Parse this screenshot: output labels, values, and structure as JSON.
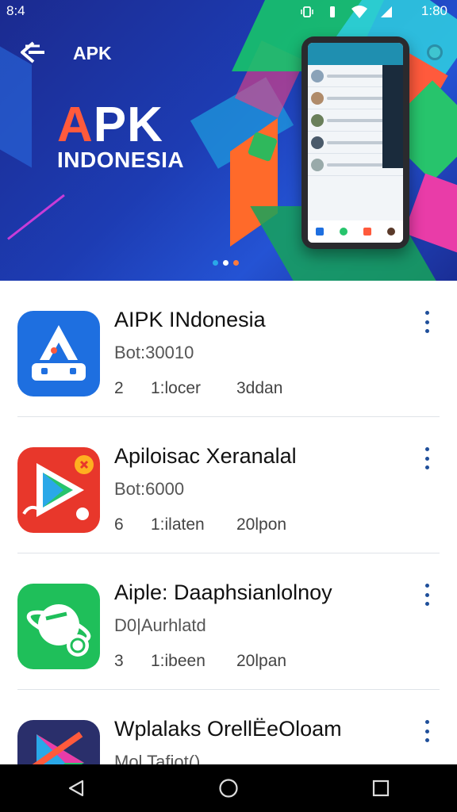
{
  "status_bar": {
    "time": "8:4",
    "clock": "1:80"
  },
  "header": {
    "title": "APK"
  },
  "banner": {
    "logo_accent": "A",
    "logo_rest": "PK",
    "subtitle": "INDONESIA",
    "carousel_count": 3,
    "carousel_colors": [
      "#2aa8e8",
      "#ffffff",
      "#ff7a3c"
    ]
  },
  "apps": [
    {
      "title": "AIPK INdonesia",
      "sub": "Bot:30010",
      "meta": [
        "2",
        "1:locer",
        "3ddan"
      ],
      "icon": "apk-indonesia-icon",
      "icon_bg": "#1e6fe0"
    },
    {
      "title": "Apiloisac Xeranalal",
      "sub": "Bot:6000",
      "meta": [
        "6",
        "1:ilaten",
        "20lpon"
      ],
      "icon": "play-store-icon",
      "icon_bg": "#e8372b"
    },
    {
      "title": "Aiple: Daaphsianlolnoy",
      "sub": "D0|Aurhlatd",
      "meta": [
        "3",
        "1:ibeen",
        "20lpan"
      ],
      "icon": "planet-app-icon",
      "icon_bg": "#1fbf5a"
    },
    {
      "title": "Wplalaks OrellЁeOloam",
      "sub": "Mol Tafiot()",
      "meta": [
        "",
        "",
        ""
      ],
      "icon": "launcher-app-icon",
      "icon_bg": "#2a2f6b"
    }
  ],
  "navbar": {
    "items": [
      "back-icon",
      "home-icon",
      "recents-icon"
    ]
  }
}
